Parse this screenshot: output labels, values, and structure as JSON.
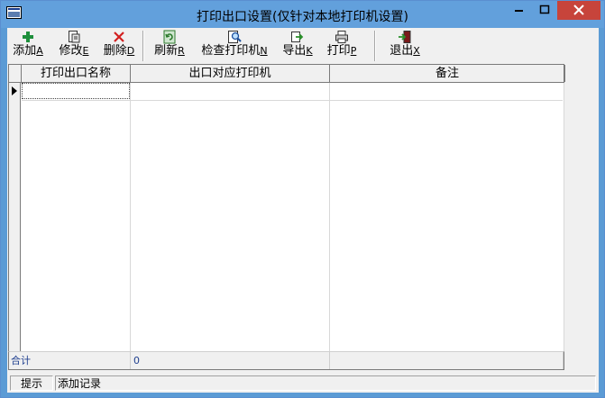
{
  "window": {
    "title": "打印出口设置(仅针对本地打印机设置)",
    "controls": {
      "minimize": "─",
      "maximize": "□",
      "close": "✕"
    }
  },
  "toolbar": {
    "items": [
      {
        "label": "添加",
        "hotkey": "A",
        "icon": "plus-icon"
      },
      {
        "label": "修改",
        "hotkey": "E",
        "icon": "edit-doc-icon"
      },
      {
        "label": "删除",
        "hotkey": "D",
        "icon": "delete-x-icon"
      },
      {
        "label": "刷新",
        "hotkey": "R",
        "icon": "refresh-icon"
      },
      {
        "label": "检查打印机",
        "hotkey": "N",
        "icon": "magnifier-doc-icon"
      },
      {
        "label": "导出",
        "hotkey": "K",
        "icon": "export-icon"
      },
      {
        "label": "打印",
        "hotkey": "P",
        "icon": "printer-icon"
      },
      {
        "label": "退出",
        "hotkey": "X",
        "icon": "exit-door-icon"
      }
    ]
  },
  "grid": {
    "columns": [
      "打印出口名称",
      "出口对应打印机",
      "备注"
    ],
    "footer": {
      "label": "合计",
      "count": "0"
    }
  },
  "statusbar": {
    "hint_label": "提示",
    "message": "添加记录"
  },
  "colors": {
    "titlebar": "#62a0dc",
    "close": "#c7443b",
    "accent_text": "#1f3f8f"
  }
}
